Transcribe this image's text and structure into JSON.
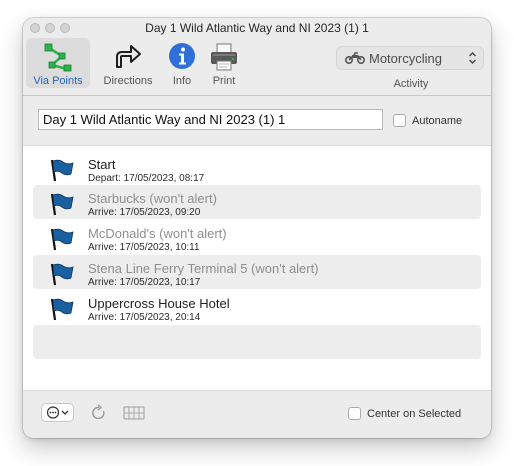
{
  "window": {
    "title": "Day 1 Wild Atlantic Way and NI 2023 (1) 1"
  },
  "toolbar": {
    "via_points": "Via Points",
    "directions": "Directions",
    "info": "Info",
    "print": "Print"
  },
  "activity": {
    "value": "Motorcycling",
    "label": "Activity"
  },
  "route_name": {
    "value": "Day 1 Wild Atlantic Way and NI 2023 (1) 1",
    "autoname_label": "Autoname"
  },
  "points": [
    {
      "name": "Start",
      "time": "Depart: 17/05/2023, 08:17"
    },
    {
      "name": "Starbucks (won't alert)",
      "time": "Arrive: 17/05/2023, 09:20"
    },
    {
      "name": "McDonald's (won't alert)",
      "time": "Arrive: 17/05/2023, 10:11"
    },
    {
      "name": "Stena Line Ferry Terminal 5 (won't alert)",
      "time": "Arrive: 17/05/2023, 10:17"
    },
    {
      "name": "Uppercross House Hotel",
      "time": "Arrive: 17/05/2023, 20:14"
    }
  ],
  "footer": {
    "center_on_selected_label": "Center on Selected"
  },
  "colors": {
    "accent": "#2a62c9",
    "flag": "#1a5fa0",
    "via_green": "#2bb34a"
  }
}
